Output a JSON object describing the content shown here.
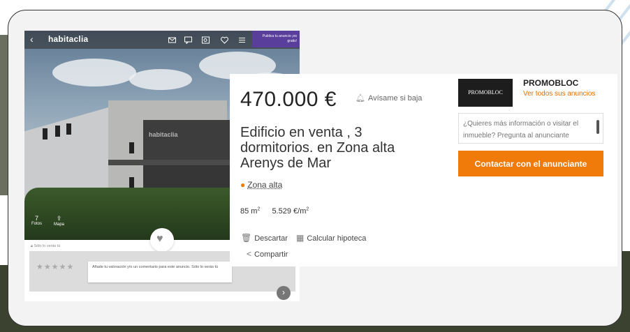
{
  "topbar": {
    "logo": "habitaclia",
    "publish_label": "Publica tu anuncio ¡es gratis!"
  },
  "photo": {
    "watermark": "habitaclia",
    "photos_count": "7",
    "photos_label": "Fotos",
    "map_label": "Mapa"
  },
  "rating": {
    "only_you": "Sólo lo verás tú",
    "stars": "★★★★★",
    "tooltip": "Añade tu valoración y/o un comentario para este anuncio. Sólo lo verás tú"
  },
  "listing": {
    "price": "470.000 €",
    "alert_label": "Avísame si baja",
    "title": "Edificio en venta , 3 dormitorios. en Zona alta Arenys de Mar",
    "zone": "Zona alta",
    "area": "85 m",
    "area_sup": "2",
    "price_per_m2": "5.529 €/m",
    "price_per_m2_sup": "2"
  },
  "actions": {
    "discard": "Descartar",
    "mortgage": "Calcular hipoteca",
    "share": "Compartir"
  },
  "advertiser": {
    "logo_text": "PROMOBLOC",
    "name": "PROMOBLOC",
    "see_all": "Ver todos sus anuncios",
    "message_placeholder": "¿Quieres más información o visitar el inmueble? Pregunta al anunciante",
    "contact_button": "Contactar con el anunciante"
  },
  "colors": {
    "accent": "#f07a0a",
    "publish": "#5a3e9c"
  }
}
